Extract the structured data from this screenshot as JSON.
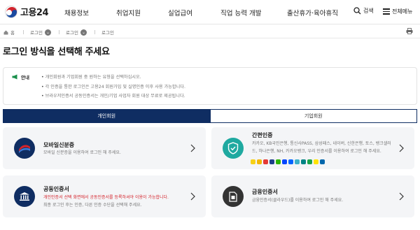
{
  "header": {
    "logo_text": "고용24",
    "nav": [
      "채용정보",
      "취업지원",
      "실업급여",
      "직업 능력 개발",
      "출산휴가·육아휴직"
    ],
    "search_label": "검색",
    "menu_label": "전체메뉴"
  },
  "breadcrumb": {
    "home": "홈",
    "items": [
      "로그인",
      "로그인",
      "로그인"
    ]
  },
  "page_title": "로그인 방식을 선택해 주세요",
  "notice": {
    "tag": "안내",
    "lines": [
      "개인회원과 기업회원 중 원하는 유형을 선택하십시오.",
      "각 인증을 통한 로그인은 고용24 회원가입 및 실명인증 이후 사용 가능합니다.",
      "브라우저인증서 공동인증서는 개인/기업 사업자 회원 대상 무료로 제공됩니다."
    ]
  },
  "tabs": [
    {
      "label": "개인회원",
      "active": true
    },
    {
      "label": "기업회원",
      "active": false
    }
  ],
  "cards": {
    "mobile_id": {
      "title": "모바일신분증",
      "desc": [
        "모바일 신분증을 이용하여 로그인 해 주세요."
      ]
    },
    "simple_auth": {
      "title": "간편인증",
      "desc": [
        "카카오, KB국민은행, 통신사PASS, 삼성패스, 네이버, 신한은행, 토스, 뱅크샐러",
        "드, 하나은행, NH, 카카오뱅크, 우리 인증서를 이용하여 로그인 해 주세요."
      ]
    },
    "public_cert": {
      "title": "공동인증서",
      "desc_red": "개인인증서 선택 화면에서 공동인증서를 등록하셔야 이용이 가능합니다.",
      "desc": "최종 로그인 후는 인증, 다른 인증 수단을 선택해 주세요."
    },
    "financial_cert": {
      "title": "금융인증서",
      "desc": [
        "금융인증서(클라우드)를 이용하여 로그인 해 주세요."
      ]
    }
  },
  "colors": {
    "primary_navy": "#0f2d62",
    "card_bg": "#f4f5f7",
    "teal": "#1fa9a0",
    "red_text": "#d4232b"
  }
}
